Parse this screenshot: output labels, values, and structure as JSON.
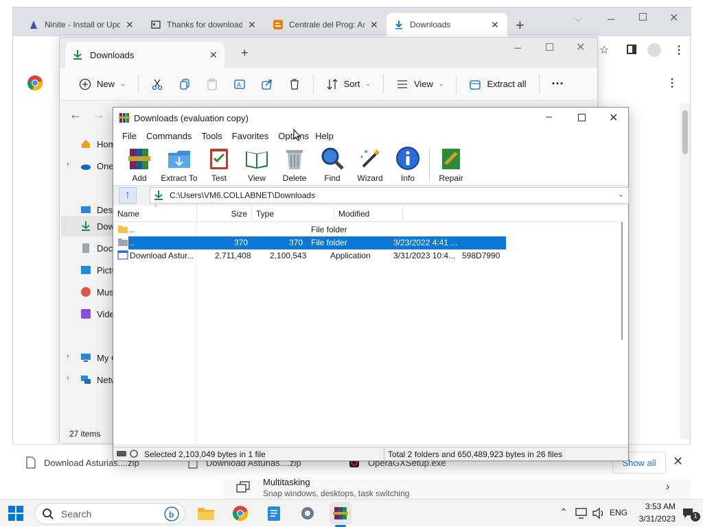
{
  "browser": {
    "tabs": [
      {
        "label": "Ninite - Install or Upd",
        "icon": "ninite-icon"
      },
      {
        "label": "Thanks for download",
        "icon": "page-icon"
      },
      {
        "label": "Centrale del Prog: As",
        "icon": "blogger-icon"
      },
      {
        "label": "Downloads",
        "icon": "download-icon"
      }
    ],
    "new_tab": "+",
    "downloads_bar": {
      "items": [
        "Download Asturias....zip",
        "Download Asturias....zip",
        "OperaGXSetup.exe"
      ],
      "show_all": "Show all",
      "tip_title": "Multitasking",
      "tip_text": "Snap windows, desktops, task switching"
    }
  },
  "explorer": {
    "tab_label": "Downloads",
    "toolbar": {
      "new": "New",
      "sort": "Sort",
      "view": "View",
      "extract_all": "Extract all",
      "more": "···"
    },
    "sidebar": [
      {
        "label": "Home",
        "icon": "home-icon"
      },
      {
        "label": "OneDrive",
        "icon": "cloud-icon"
      },
      {
        "label": "Desktop",
        "icon": "desktop-icon"
      },
      {
        "label": "Downloads",
        "icon": "download-icon"
      },
      {
        "label": "Documents",
        "icon": "documents-icon"
      },
      {
        "label": "Pictures",
        "icon": "pictures-icon"
      },
      {
        "label": "Music",
        "icon": "music-icon"
      },
      {
        "label": "Videos",
        "icon": "videos-icon"
      },
      {
        "label": "My Computer",
        "icon": "computer-icon"
      },
      {
        "label": "Network",
        "icon": "network-icon"
      }
    ],
    "item_count": "27 items"
  },
  "winrar": {
    "title": "Downloads (evaluation copy)",
    "menu": [
      "File",
      "Commands",
      "Tools",
      "Favorites",
      "Options",
      "Help"
    ],
    "toolbar": [
      "Add",
      "Extract To",
      "Test",
      "View",
      "Delete",
      "Find",
      "Wizard",
      "Info",
      "Repair"
    ],
    "path": "C:\\Users\\VM6.COLLABNET\\Downloads",
    "columns": [
      "Name",
      "Size",
      "Type",
      "Modified"
    ],
    "rows": [
      {
        "name": "..",
        "size": "",
        "packed": "",
        "type": "File folder",
        "modified": "",
        "crc": ""
      },
      {
        "name": "..",
        "size": "370",
        "packed": "370",
        "type": "File folder",
        "modified": "3/23/2022 4:41 ...",
        "crc": ""
      },
      {
        "name": "Download Astur...",
        "size": "2,711,408",
        "packed": "2,100,543",
        "type": "Application",
        "modified": "3/31/2023 10:4...",
        "crc": "598D7990"
      }
    ],
    "status_left": "Selected 2,103,049 bytes in 1 file",
    "status_right": "Total 2 folders and 650,489,923 bytes in 26 files"
  },
  "taskbar": {
    "search_placeholder": "Search",
    "lang": "ENG",
    "time": "3:53 AM",
    "date": "3/31/2023",
    "notifications": "1"
  },
  "colors": {
    "selection": "#0b78d7",
    "accent": "#0067c0"
  }
}
